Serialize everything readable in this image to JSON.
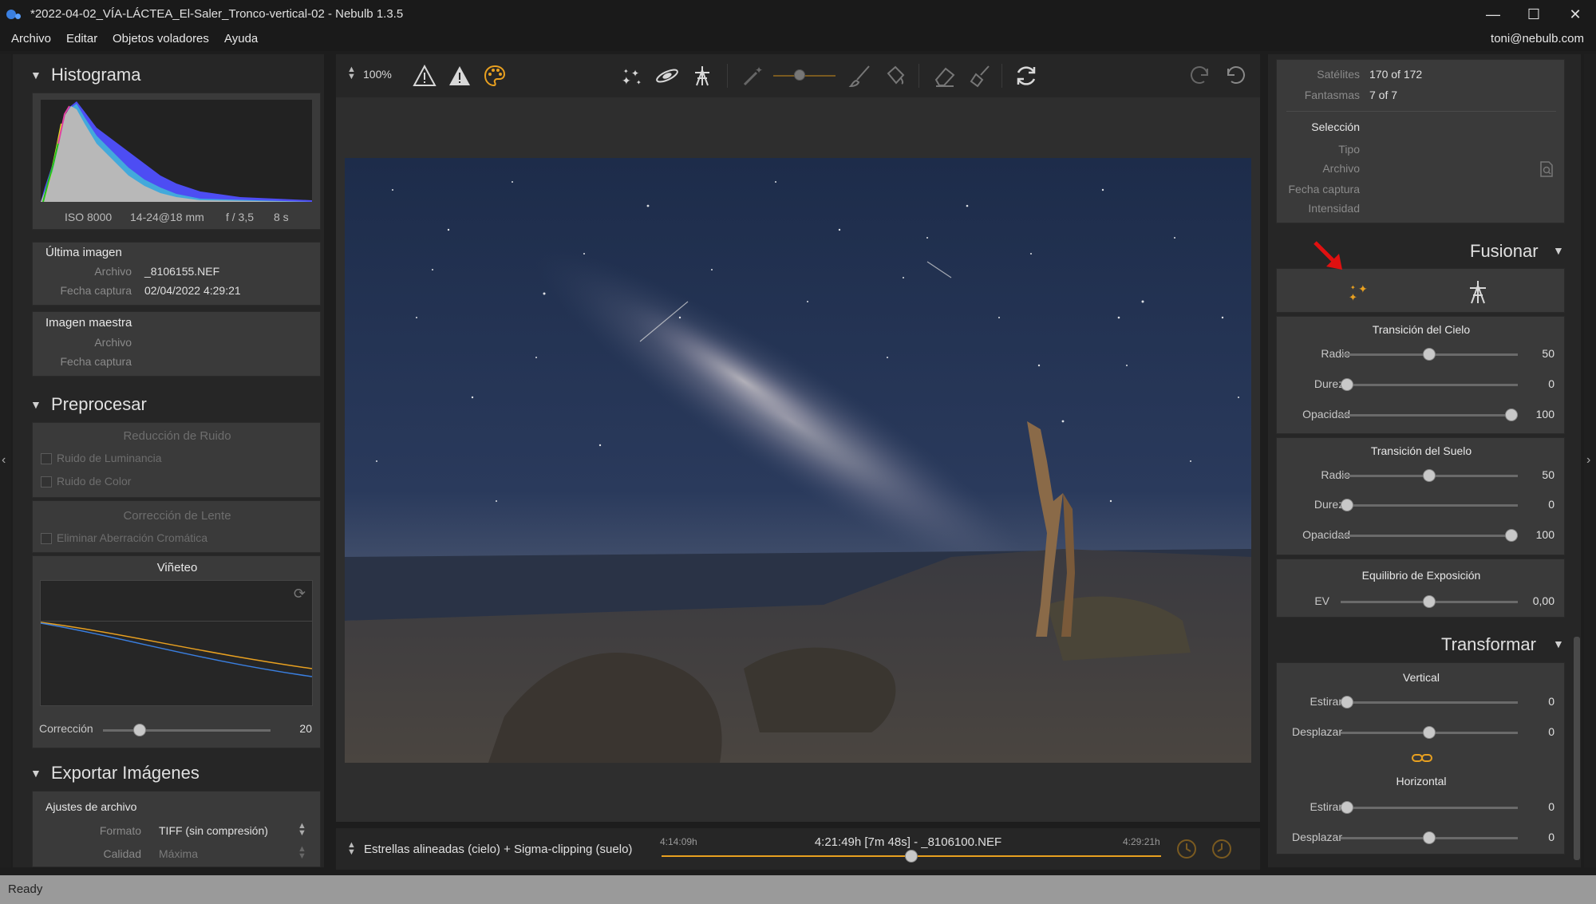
{
  "window": {
    "title": "*2022-04-02_VÍA-LÁCTEA_El-Saler_Tronco-vertical-02 - Nebulb 1.3.5",
    "minimize_icon": "minimize-icon",
    "maximize_icon": "maximize-icon",
    "close_icon": "close-icon"
  },
  "menubar": {
    "items": [
      "Archivo",
      "Editar",
      "Objetos voladores",
      "Ayuda"
    ],
    "user": "toni@nebulb.com"
  },
  "histogram": {
    "title": "Histograma",
    "iso": "ISO 8000",
    "lens": "14-24@18 mm",
    "aperture": "f / 3,5",
    "shutter": "8 s"
  },
  "last_image": {
    "title": "Última imagen",
    "file_label": "Archivo",
    "file_value": "_8106155.NEF",
    "date_label": "Fecha captura",
    "date_value": "02/04/2022 4:29:21"
  },
  "master_image": {
    "title": "Imagen maestra",
    "file_label": "Archivo",
    "date_label": "Fecha captura"
  },
  "preprocess": {
    "title": "Preprocesar",
    "noise_title": "Reducción de Ruido",
    "luminance_noise": "Ruido de Luminancia",
    "color_noise": "Ruido de Color",
    "lens_title": "Corrección de Lente",
    "chromatic": "Eliminar Aberración Cromática",
    "vignette_title": "Viñeteo",
    "correction_label": "Corrección",
    "correction_value": "20",
    "correction_level": 0.2
  },
  "export": {
    "title": "Exportar Imágenes",
    "file_settings": "Ajustes de archivo",
    "format_label": "Formato",
    "format_value": "TIFF (sin compresión)",
    "quality_label": "Calidad",
    "quality_value": "Máxima"
  },
  "toolbar": {
    "zoom": "100%"
  },
  "bottombar": {
    "mode": "Estrellas alineadas (cielo) + Sigma-clipping (suelo)",
    "time_start": "4:14:09h",
    "time_current": "4:21:49h [7m 48s] - _8106100.NEF",
    "time_end": "4:29:21h",
    "timeline_level": 0.5
  },
  "info": {
    "satellites_label": "Satélites",
    "satellites_value": "170 of 172",
    "ghosts_label": "Fantasmas",
    "ghosts_value": "7 of 7",
    "selection_title": "Selección",
    "type_label": "Tipo",
    "file_label": "Archivo",
    "date_label": "Fecha captura",
    "intensity_label": "Intensidad"
  },
  "merge": {
    "title": "Fusionar",
    "sky_title": "Transición del Cielo",
    "ground_title": "Transición del Suelo",
    "radius_label": "Radio",
    "hardness_label": "Dureza",
    "opacity_label": "Opacidad",
    "sky_radius": "50",
    "sky_hardness": "0",
    "sky_opacity": "100",
    "ground_radius": "50",
    "ground_hardness": "0",
    "ground_opacity": "100",
    "exposure_title": "Equilibrio de Exposición",
    "ev_label": "EV",
    "ev_value": "0,00"
  },
  "transform": {
    "title": "Transformar",
    "vertical_title": "Vertical",
    "horizontal_title": "Horizontal",
    "stretch_label": "Estirar",
    "shift_label": "Desplazar",
    "v_stretch": "0",
    "v_shift": "0",
    "h_stretch": "0",
    "h_shift": "0"
  },
  "status": {
    "text": "Ready"
  },
  "colors": {
    "accent": "#e8a020",
    "arrow": "#e01010"
  }
}
